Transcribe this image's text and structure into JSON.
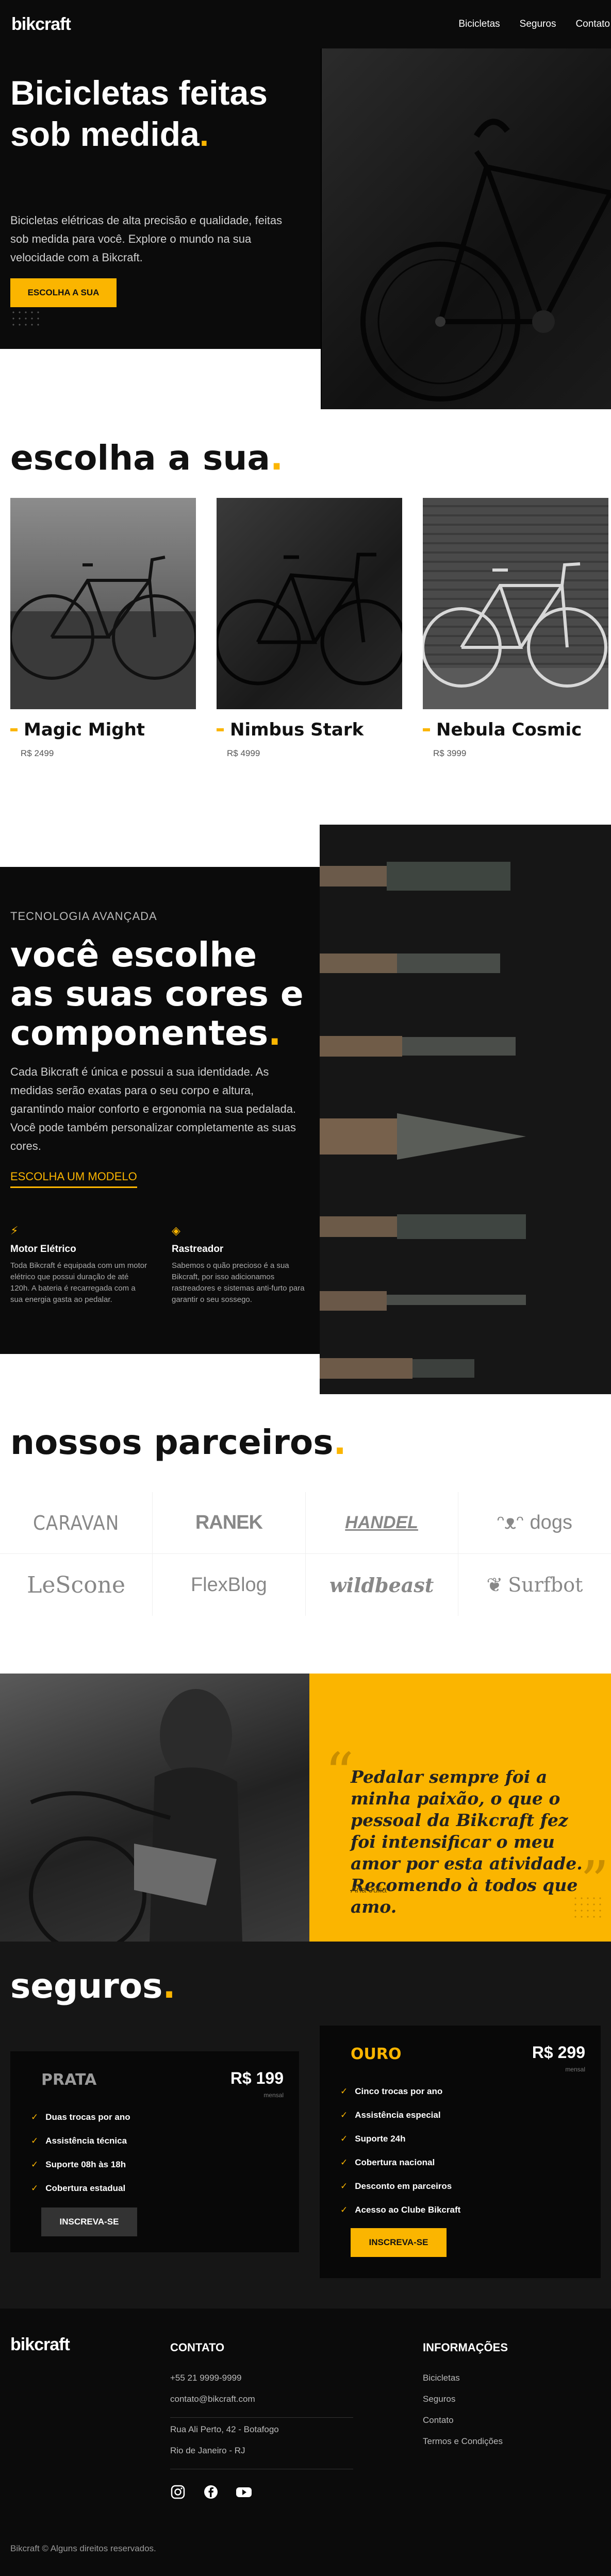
{
  "header": {
    "logo": "bikcraft",
    "nav": [
      "Bicicletas",
      "Seguros",
      "Contato"
    ]
  },
  "hero": {
    "title": "Bicicletas feitas sob medida",
    "title_dot": ".",
    "text": "Bicicletas elétricas de alta precisão e qualidade, feitas sob medida para você. Explore o mundo na sua velocidade com a Bikcraft.",
    "button": "Escolha a sua"
  },
  "escolha": {
    "title": "escolha a sua",
    "dot": ".",
    "bikes": [
      {
        "name": "Magic Might",
        "price": "R$ 2499"
      },
      {
        "name": "Nimbus Stark",
        "price": "R$ 4999"
      },
      {
        "name": "Nebula Cosmic",
        "price": "R$ 3999"
      }
    ]
  },
  "tecnologia": {
    "kicker": "Tecnologia Avançada",
    "title": "você escolhe as suas cores e componentes",
    "dot": ".",
    "text": "Cada Bikcraft é única e possui a sua identidade. As medidas serão exatas para o seu corpo e altura, garantindo maior conforto e ergonomia na sua pedalada. Você pode também personalizar completamente as suas cores.",
    "link": "Escolha um modelo",
    "features": [
      {
        "title": "Motor Elétrico",
        "text": "Toda Bikcraft é equipada com um motor elétrico que possui duração de até 120h. A bateria é recarregada com a sua energia gasta ao pedalar."
      },
      {
        "title": "Rastreador",
        "text": "Sabemos o quão precioso é a sua Bikcraft, por isso adicionamos rastreadores e sistemas anti-furto para garantir o seu sossego."
      }
    ]
  },
  "parceiros": {
    "title": "nossos parceiros",
    "dot": ".",
    "logos": [
      "CARAVAN",
      "RANEK",
      "HANDEL",
      "dogs",
      "LeScone",
      "FlexBlog",
      "wildbeast",
      "Surfbot"
    ]
  },
  "testimonial": {
    "quote": "Pedalar sempre foi a minha paixão, o que o pessoal da Bikcraft fez foi intensificar o meu amor por esta atividade. Recomendo à todos que amo.",
    "author": "Ana Júlia"
  },
  "seguros": {
    "title": "seguros",
    "dot": ".",
    "plans": [
      {
        "name": "PRATA",
        "price": "R$ 199",
        "period": "mensal",
        "items": [
          "Duas trocas por ano",
          "Assistência técnica",
          "Suporte 08h às 18h",
          "Cobertura estadual"
        ],
        "button": "Inscreva-se"
      },
      {
        "name": "OURO",
        "price": "R$ 299",
        "period": "mensal",
        "items": [
          "Cinco trocas por ano",
          "Assistência especial",
          "Suporte 24h",
          "Cobertura nacional",
          "Desconto em parceiros",
          "Acesso ao Clube Bikcraft"
        ],
        "button": "Inscreva-se"
      }
    ]
  },
  "footer": {
    "logo": "bikcraft",
    "contato_title": "Contato",
    "phone": "+55 21 9999-9999",
    "email": "contato@bikcraft.com",
    "address1": "Rua Ali Perto, 42 - Botafogo",
    "address2": "Rio de Janeiro - RJ",
    "info_title": "Informações",
    "info_links": [
      "Bicicletas",
      "Seguros",
      "Contato",
      "Termos e Condições"
    ],
    "social": [
      "instagram-icon",
      "facebook-icon",
      "youtube-icon"
    ],
    "copyright": "Bikcraft © Alguns direitos reservados."
  },
  "colors": {
    "accent": "#fbb500",
    "dark": "#0b0b0b",
    "plan_dark": "#080808"
  }
}
